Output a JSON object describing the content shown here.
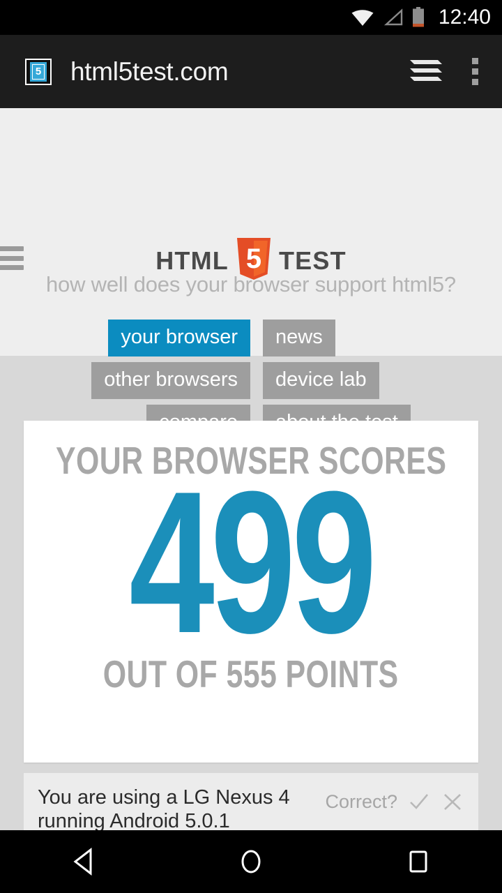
{
  "status_bar": {
    "time": "12:40",
    "icons": [
      "wifi-icon",
      "cell-signal-icon",
      "battery-icon"
    ],
    "battery_accent": "#c4542a",
    "background": "#000000"
  },
  "browser_chrome": {
    "favicon": "html5-shield-favicon",
    "favicon_digit": "5",
    "url": "html5test.com",
    "tabs_icon": "tab-stack-icon",
    "overflow_icon": "overflow-menu-icon",
    "background": "#1d1d1d"
  },
  "site_header": {
    "menu_icon": "hamburger-menu-icon",
    "logo": {
      "word_left": "HTML",
      "shield_digit": "5",
      "word_right": "TEST",
      "shield_color": "#e44d26",
      "shield_color_dark": "#f16529"
    },
    "tagline": "how well does your browser support html5?",
    "background": "#eeeeee"
  },
  "nav": {
    "active_color": "#0b8cc0",
    "inactive_color": "#9e9e9e",
    "left_column": [
      {
        "label": "your browser",
        "active": true
      },
      {
        "label": "other browsers",
        "active": false
      },
      {
        "label": "compare",
        "active": false
      }
    ],
    "right_column": [
      {
        "label": "news",
        "active": false
      },
      {
        "label": "device lab",
        "active": false
      },
      {
        "label": "about the test",
        "active": false
      }
    ]
  },
  "score_card": {
    "title": "YOUR BROWSER SCORES",
    "score": "499",
    "subtitle": "OUT OF 555 POINTS",
    "score_color": "#1b8fba",
    "label_color": "#a8a8a8",
    "card_background": "#ffffff"
  },
  "device_bar": {
    "text": "You are using a LG Nexus 4 running Android 5.0.1",
    "correct_label": "Correct?",
    "confirm_icon": "check-icon",
    "reject_icon": "close-icon",
    "background": "#ececec"
  },
  "android_nav": {
    "back": "back-triangle-icon",
    "home": "home-circle-icon",
    "recents": "recents-square-icon",
    "background": "#000000"
  }
}
